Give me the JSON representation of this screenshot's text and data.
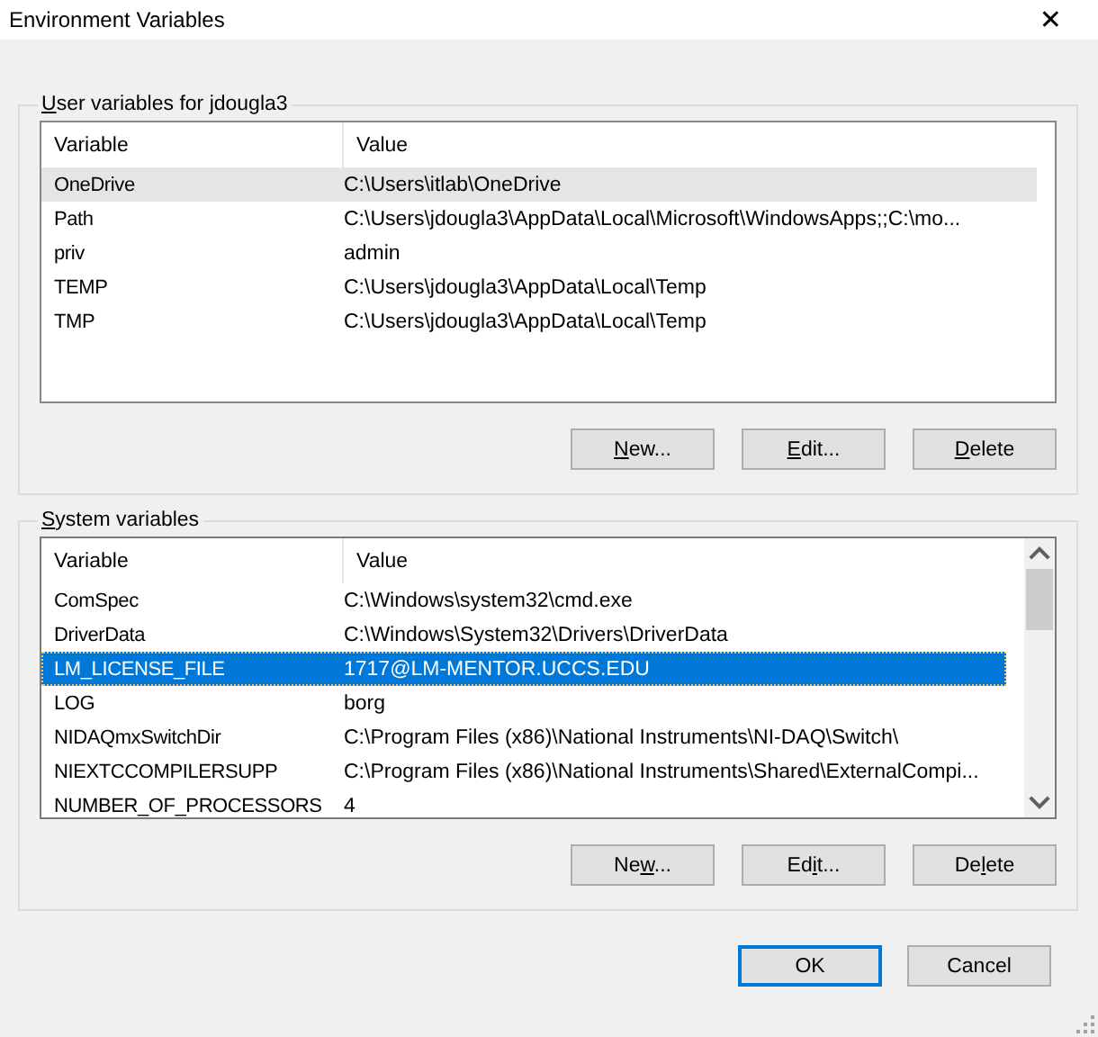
{
  "window": {
    "title": "Environment Variables",
    "close": "✕"
  },
  "groups": [
    {
      "title": {
        "access_key": "U",
        "after": "ser variables for jdougla3"
      },
      "focused": false,
      "columns": [
        "Variable",
        "Value"
      ],
      "rows": [
        {
          "variable": "OneDrive",
          "value": "C:\\Users\\itlab\\OneDrive",
          "selected": true
        },
        {
          "variable": "Path",
          "value": "C:\\Users\\jdougla3\\AppData\\Local\\Microsoft\\WindowsApps;;C:\\mo...",
          "selected": false
        },
        {
          "variable": "priv",
          "value": "admin",
          "selected": false
        },
        {
          "variable": "TEMP",
          "value": "C:\\Users\\jdougla3\\AppData\\Local\\Temp",
          "selected": false
        },
        {
          "variable": "TMP",
          "value": "C:\\Users\\jdougla3\\AppData\\Local\\Temp",
          "selected": false
        }
      ],
      "buttons": [
        {
          "access_key": "N",
          "after": "ew..."
        },
        {
          "access_key": "E",
          "after": "dit..."
        },
        {
          "access_key": "D",
          "after": "elete"
        }
      ]
    },
    {
      "title": {
        "access_key": "S",
        "after": "ystem variables"
      },
      "focused": true,
      "scrollbar": true,
      "columns": [
        "Variable",
        "Value"
      ],
      "rows": [
        {
          "variable": "ComSpec",
          "value": "C:\\Windows\\system32\\cmd.exe",
          "selected": false
        },
        {
          "variable": "DriverData",
          "value": "C:\\Windows\\System32\\Drivers\\DriverData",
          "selected": false
        },
        {
          "variable": "LM_LICENSE_FILE",
          "value": "1717@LM-MENTOR.UCCS.EDU",
          "selected": true
        },
        {
          "variable": "LOG",
          "value": "borg",
          "selected": false
        },
        {
          "variable": "NIDAQmxSwitchDir",
          "value": "C:\\Program Files (x86)\\National Instruments\\NI-DAQ\\Switch\\",
          "selected": false
        },
        {
          "variable": "NIEXTCCOMPILERSUPP",
          "value": "C:\\Program Files (x86)\\National Instruments\\Shared\\ExternalCompi...",
          "selected": false
        },
        {
          "variable": "NUMBER_OF_PROCESSORS",
          "value": "4",
          "selected": false
        }
      ],
      "buttons": [
        {
          "before": "Ne",
          "access_key": "w",
          "after": "..."
        },
        {
          "before": "Ed",
          "access_key": "i",
          "after": "t..."
        },
        {
          "before": "De",
          "access_key": "l",
          "after": "ete"
        }
      ]
    }
  ],
  "footer_buttons": [
    {
      "label": "OK",
      "default": true
    },
    {
      "label": "Cancel",
      "default": false
    }
  ]
}
